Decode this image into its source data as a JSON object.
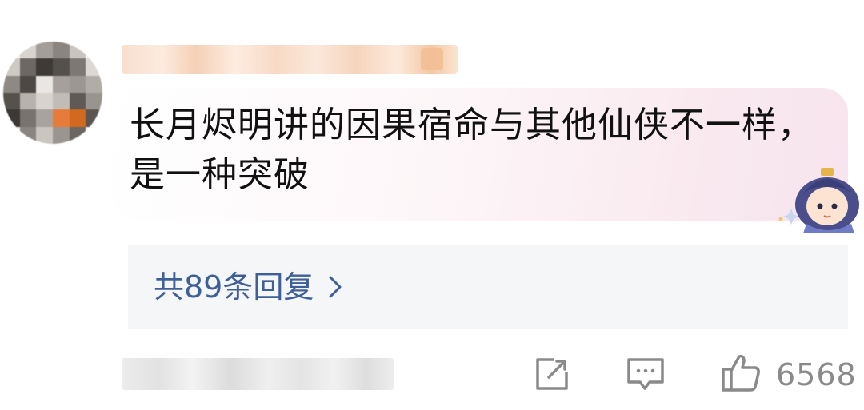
{
  "comment": {
    "text": "长月烬明讲的因果宿命与其他仙侠不一样，\n是一种突破",
    "reply_summary": "共89条回复"
  },
  "actions": {
    "like_count": "6568",
    "share_icon": "share-icon",
    "comment_icon": "comment-icon",
    "like_icon": "thumbs-up-icon"
  },
  "colors": {
    "reply_link": "#3f5f98",
    "icon_gray": "#8a8a8a",
    "bubble_pink": "#f7e4ee"
  }
}
